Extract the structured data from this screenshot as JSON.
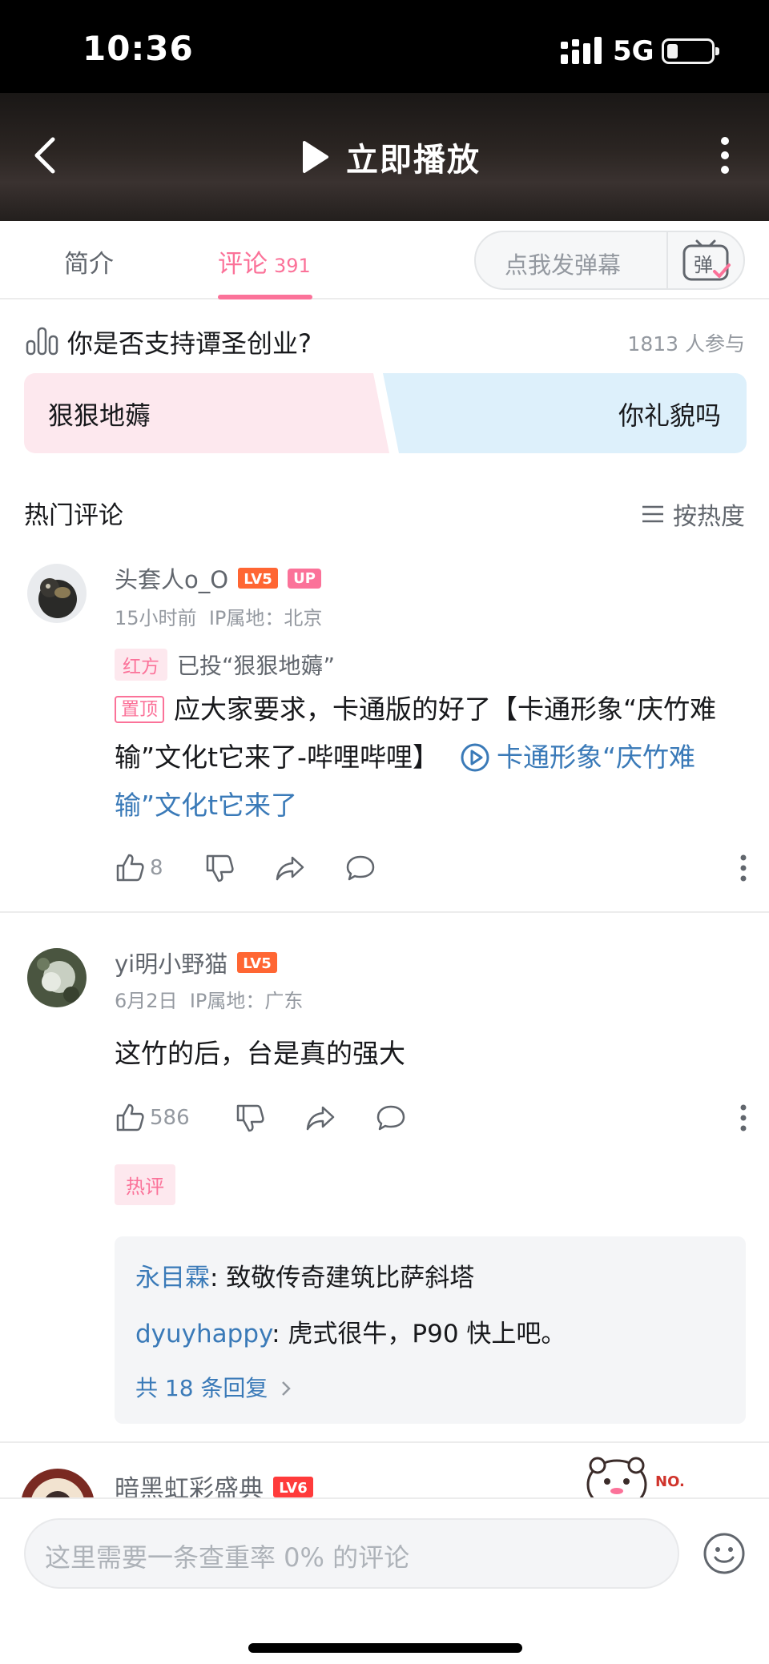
{
  "status": {
    "time": "10:36",
    "network": "5G"
  },
  "player": {
    "play_label": "立即播放"
  },
  "tabs": {
    "intro": "简介",
    "comments": "评论",
    "comment_count": "391",
    "danmaku_placeholder": "点我发弹幕",
    "danmaku_button": "弹"
  },
  "poll": {
    "question": "你是否支持谭圣创业?",
    "participants": "1813 人参与",
    "option_red": "狠狠地薅",
    "option_blue": "你礼貌吗"
  },
  "hot": {
    "title": "热门评论",
    "sort_label": "按热度"
  },
  "comments": [
    {
      "username": "头套人o_O",
      "level": "LV5",
      "up_badge": "UP",
      "time": "15小时前",
      "ip": "IP属地：北京",
      "vote_tag": "红方",
      "vote_text": "已投“狠狠地薅”",
      "pin_tag": "置顶",
      "text": "应大家要求，卡通版的好了【卡通形象“庆竹难输”文化t它来了-哔哩哔哩】",
      "link_text": "卡通形象“庆竹难输”文化t它来了",
      "likes": "8"
    },
    {
      "username": "yi明小野猫",
      "level": "LV5",
      "time": "6月2日",
      "ip": "IP属地：广东",
      "text": "这竹的后，台是真的强大",
      "likes": "586",
      "hot_tag": "热评",
      "replies": [
        {
          "user": "永目霖",
          "text": ": 致敬传奇建筑比萨斜塔"
        },
        {
          "user": "dyuyhappy",
          "text": ": 虎式很牛，P90 快上吧。"
        }
      ],
      "reply_more": "共 18 条回复"
    },
    {
      "username": "暗黑虹彩盛典",
      "level": "LV6",
      "badge_text": "NO."
    }
  ],
  "input": {
    "placeholder": "这里需要一条查重率 0% 的评论"
  },
  "colors": {
    "accent": "#fb7299",
    "link": "#3a7ab8",
    "level": "#ff6633"
  }
}
